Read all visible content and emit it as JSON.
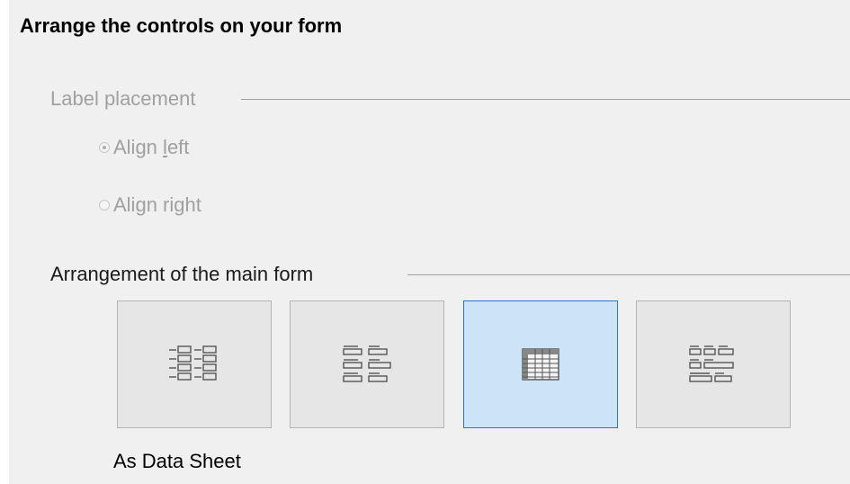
{
  "heading": "Arrange the controls on your form",
  "label_placement": {
    "legend": "Label placement",
    "options": [
      {
        "label_pre": "Align ",
        "label_key": "l",
        "label_post": "eft",
        "checked": true
      },
      {
        "label_pre": "Ali",
        "label_key": "g",
        "label_post": "n right",
        "checked": false
      }
    ]
  },
  "main_form": {
    "legend": "Arrangement of the main form",
    "tiles": [
      {
        "icon": "columnar-labels-left-icon",
        "selected": false
      },
      {
        "icon": "columnar-labels-top-icon",
        "selected": false
      },
      {
        "icon": "data-sheet-icon",
        "selected": true
      },
      {
        "icon": "block-labels-above-icon",
        "selected": false
      }
    ],
    "selected_caption": "As Data Sheet"
  },
  "colors": {
    "panel_bg": "#f0f0f0",
    "disabled_text": "#a0a0a0",
    "selected_border": "#2b73c9",
    "selected_fill": "#cce4f7"
  }
}
